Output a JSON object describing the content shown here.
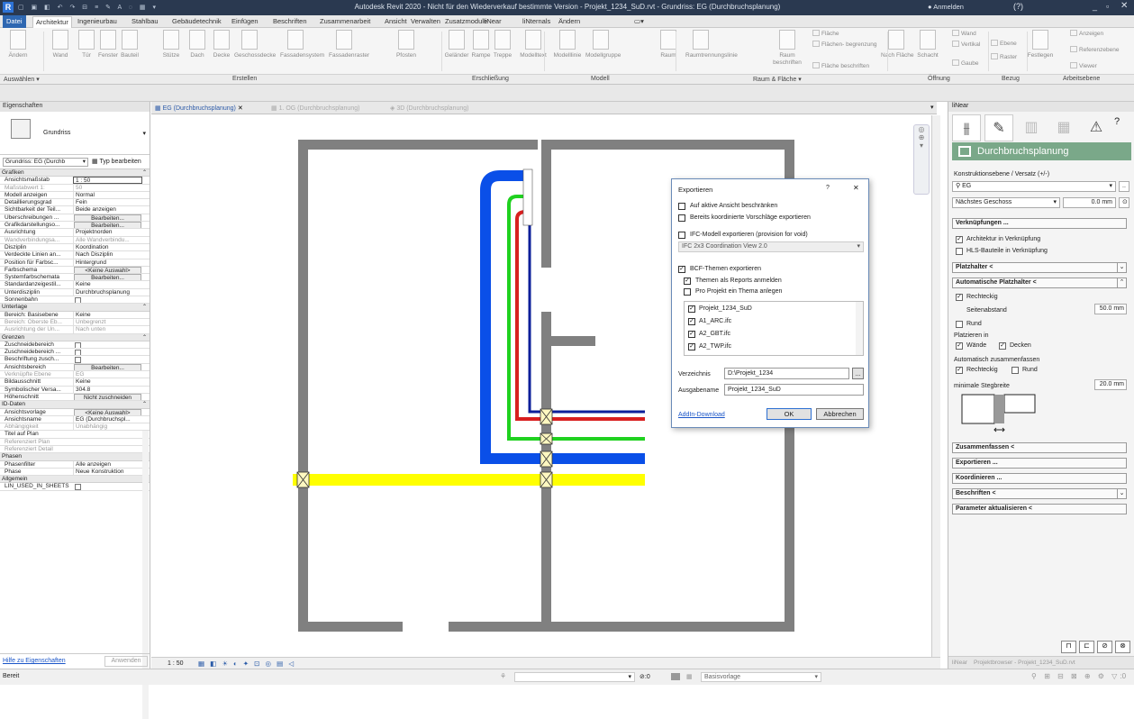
{
  "app": {
    "title": "Autodesk Revit 2020 - Nicht für den Wiederverkauf bestimmte Version - Projekt_1234_SuD.rvt - Grundriss: EG (Durchbruchsplanung)",
    "login": "Anmelden",
    "help": "?"
  },
  "tabs": [
    "Datei",
    "Architektur",
    "Ingenieurbau",
    "Stahlbau",
    "Gebäudetechnik",
    "Einfügen",
    "Beschriften",
    "Zusammenarbeit",
    "Ansicht",
    "Verwalten",
    "Zusatzmodule",
    "liNear",
    "liNternals",
    "Ändern"
  ],
  "ribbon": {
    "buttons": [
      "Ändern",
      "Wand",
      "Tür",
      "Fenster",
      "Bauteil",
      "Stütze",
      "Dach",
      "Decke",
      "Geschossdecke",
      "Fassadensystem",
      "Fassadenraster",
      "Pfosten",
      "Geländer",
      "Rampe",
      "Treppe",
      "Modelltext",
      "Modelllinie",
      "Modellgruppe",
      "Raum",
      "Raumtrennungslinie",
      "Nach Fläche",
      "Schacht",
      "Festlegen"
    ],
    "raum_beschriften": "Raum beschriften",
    "small": {
      "flaeche": "Fläche",
      "flaechengrenz": "Flächen- begrenzung",
      "flaeche_beschriften": "Fläche beschriften",
      "wand": "Wand",
      "vertikal": "Vertikal",
      "gaube": "Gaube",
      "ebene": "Ebene",
      "raster": "Raster",
      "anzeigen": "Anzeigen",
      "referenzebene": "Referenzebene",
      "viewer": "Viewer"
    },
    "panels": {
      "auswaehlen": "Auswählen",
      "erstellen": "Erstellen",
      "erschliessung": "Erschließung",
      "modell": "Modell",
      "raum": "Raum & Fläche",
      "oeffnung": "Öffnung",
      "bezug": "Bezug",
      "arbeitsebene": "Arbeitsebene"
    }
  },
  "props": {
    "title": "Eigenschaften",
    "type": "Grundriss",
    "instance": "Grundriss: EG (Durchb",
    "edit_type": "Typ bearbeiten",
    "rows": [
      {
        "g": "Grafiken"
      },
      {
        "k": "Ansichtsmaßstab",
        "v": "1 : 50",
        "t": "inp"
      },
      {
        "k": "Maßstabwert 1:",
        "v": "50",
        "gray": true
      },
      {
        "k": "Modell anzeigen",
        "v": "Normal"
      },
      {
        "k": "Detaillierungsgrad",
        "v": "Fein"
      },
      {
        "k": "Sichtbarkeit der Teil...",
        "v": "Beide anzeigen"
      },
      {
        "k": "Überschreibungen ...",
        "v": "Bearbeiten...",
        "t": "btn"
      },
      {
        "k": "Grafikdarstellungso...",
        "v": "Bearbeiten...",
        "t": "btn"
      },
      {
        "k": "Ausrichtung",
        "v": "Projektnorden"
      },
      {
        "k": "Wandverbindungsa...",
        "v": "Alle Wandverbindu...",
        "gray": true
      },
      {
        "k": "Disziplin",
        "v": "Koordination"
      },
      {
        "k": "Verdeckte Linien an...",
        "v": "Nach Disziplin"
      },
      {
        "k": "Position für Farbsc...",
        "v": "Hintergrund"
      },
      {
        "k": "Farbschema",
        "v": "<Keine Auswahl>",
        "t": "btn"
      },
      {
        "k": "Systemfarbschemata",
        "v": "Bearbeiten...",
        "t": "btn"
      },
      {
        "k": "Standardanzeigestil...",
        "v": "Keine"
      },
      {
        "k": "Unterdisziplin",
        "v": "Durchbruchsplanung"
      },
      {
        "k": "Sonnenbahn",
        "v": "",
        "t": "cb"
      },
      {
        "g": "Unterlage"
      },
      {
        "k": "Bereich: Basisebene",
        "v": "Keine"
      },
      {
        "k": "Bereich: Oberste Eb...",
        "v": "Unbegrenzt",
        "gray": true
      },
      {
        "k": "Ausrichtung der Un...",
        "v": "Nach unten",
        "gray": true
      },
      {
        "g": "Grenzen"
      },
      {
        "k": "Zuschneidebereich",
        "v": "",
        "t": "cb"
      },
      {
        "k": "Zuschneidebereich ...",
        "v": "",
        "t": "cb"
      },
      {
        "k": "Beschriftung zusch...",
        "v": "",
        "t": "cb"
      },
      {
        "k": "Ansichtsbereich",
        "v": "Bearbeiten...",
        "t": "btn"
      },
      {
        "k": "Verknüpfte Ebene",
        "v": "EG",
        "gray": true
      },
      {
        "k": "Bildausschnitt",
        "v": "Keine"
      },
      {
        "k": "Symbolischer Versa...",
        "v": "304.8"
      },
      {
        "k": "Höhenschnitt",
        "v": "Nicht zuschneiden",
        "t": "btn"
      },
      {
        "g": "ID-Daten"
      },
      {
        "k": "Ansichtsvorlage",
        "v": "<Keine Auswahl>",
        "t": "btn"
      },
      {
        "k": "Ansichtsname",
        "v": "EG (Durchbruchspl..."
      },
      {
        "k": "Abhängigkeit",
        "v": "Unabhängig",
        "gray": true
      },
      {
        "k": "Titel auf Plan",
        "v": ""
      },
      {
        "k": "Referenziert Plan",
        "v": "",
        "gray": true
      },
      {
        "k": "Referenziert Detail",
        "v": "",
        "gray": true
      },
      {
        "g": "Phasen"
      },
      {
        "k": "Phasenfilter",
        "v": "Alle anzeigen"
      },
      {
        "k": "Phase",
        "v": "Neue Konstruktion"
      },
      {
        "g": "Allgemein"
      },
      {
        "k": "LIN_USED_IN_SHEETS",
        "v": "",
        "t": "cb"
      }
    ],
    "help": "Hilfe zu Eigenschaften",
    "apply": "Anwenden"
  },
  "viewtabs": [
    "EG (Durchbruchsplanung)",
    "1. OG (Durchbruchsplanung)",
    "3D (Durchbruchsplanung)"
  ],
  "viewbar": {
    "scale": "1 : 50"
  },
  "status": {
    "ready": "Bereit",
    "zero": ":0",
    "workset": "Basisvorlage",
    "filter": ":0"
  },
  "dialog": {
    "title": "Exportieren",
    "help": "?",
    "close": "X",
    "opt1": "Auf aktive Ansicht beschränken",
    "opt2": "Bereits koordinierte Vorschläge exportieren",
    "ifc": "IFC-Modell exportieren (provision for void)",
    "ifcver": "IFC 2x3 Coordination View 2.0",
    "bcf": "BCF-Themen exportieren",
    "reports": "Themen als Reports anmelden",
    "proproj": "Pro Projekt ein Thema anlegen",
    "files": [
      "Projekt_1234_SuD",
      "A1_ARC.ifc",
      "A2_GBT.ifc",
      "A2_TWP.ifc"
    ],
    "dir_label": "Verzeichnis",
    "dir": "D:\\Projekt_1234",
    "dir_btn": "...",
    "out_label": "Ausgabename",
    "out": "Projekt_1234_SuD",
    "addin": "AddIn-Download",
    "ok": "OK",
    "cancel": "Abbrechen"
  },
  "linear": {
    "header": "liNear",
    "banner": "Durchbruchsplanung",
    "ks_label": "Konstruktionsebene / Versatz (+/-)",
    "level": "EG",
    "next": "Nächstes Geschoss",
    "offset": "0.0 mm",
    "links": "Verknüpfungen ...",
    "arch_link": "Architektur in Verknüpfung",
    "hls_link": "HLS-Bauteile in Verknüpfung",
    "placeholder": "Platzhalter <",
    "auto": "Automatische Platzhalter <",
    "rect": "Rechteckig",
    "side": "Seitenabstand",
    "side_val": "50.0 mm",
    "round": "Rund",
    "place_in": "Platzieren in",
    "walls": "Wände",
    "ceilings": "Decken",
    "merge_auto": "Automatisch zusammenfassen",
    "rect2": "Rechteckig",
    "round2": "Rund",
    "min_web": "minimale Stegbreite",
    "min_web_val": "20.0 mm",
    "sections": [
      "Zusammenfassen <",
      "Exportieren ...",
      "Koordinieren ...",
      "Beschriften <",
      "Parameter aktualisieren <"
    ],
    "bottom_tabs": [
      "liNear",
      "Projektbrowser - Projekt_1234_SuD.rvt"
    ]
  },
  "colors": {
    "blue": "#0a4fe8",
    "green": "#1fd11f",
    "red": "#d81f1f",
    "navy": "#0b1f9a",
    "yellow": "#ffff00",
    "wall": "#808080"
  }
}
